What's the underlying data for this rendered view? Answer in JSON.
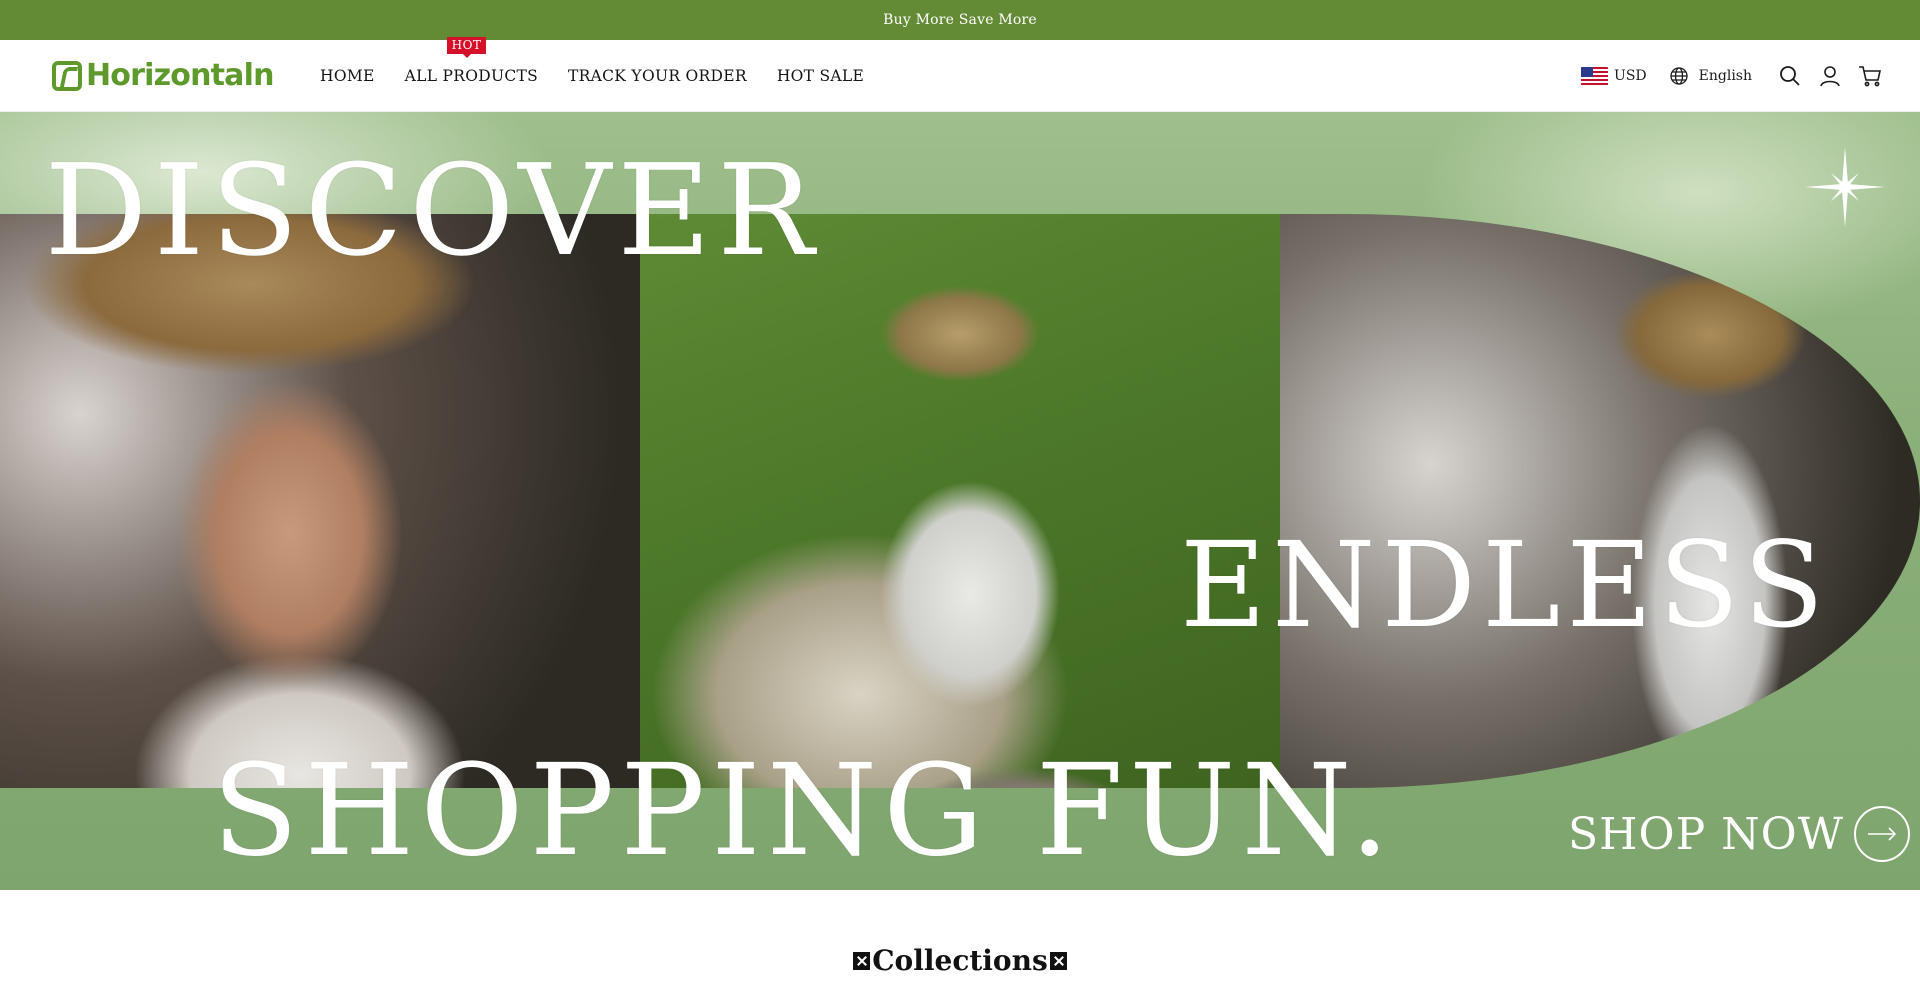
{
  "announcement": {
    "text": "Buy More Save More"
  },
  "header": {
    "logo_text": "Horizontaln",
    "nav": [
      {
        "label": "HOME"
      },
      {
        "label": "ALL PRODUCTS",
        "badge": "HOT"
      },
      {
        "label": "TRACK YOUR ORDER"
      },
      {
        "label": "HOT SALE"
      }
    ],
    "currency": {
      "code": "USD",
      "flag_icon": "us-flag-icon"
    },
    "language": {
      "label": "English",
      "icon": "globe-icon"
    },
    "icons": [
      "search-icon",
      "account-icon",
      "cart-icon"
    ]
  },
  "hero": {
    "line1": "DISCOVER",
    "line2": "ENDLESS",
    "line3": "SHOPPING FUN.",
    "cta": "SHOP NOW",
    "cta_icon": "arrow-right-icon",
    "sparkle_icon": "sparkle-icon"
  },
  "collections": {
    "title": "Collections"
  },
  "colors": {
    "announcement_bg": "#638a35",
    "brand_green": "#5d9a2b",
    "hot_badge": "#d7102a",
    "hero_bg": "#8bb07a"
  }
}
